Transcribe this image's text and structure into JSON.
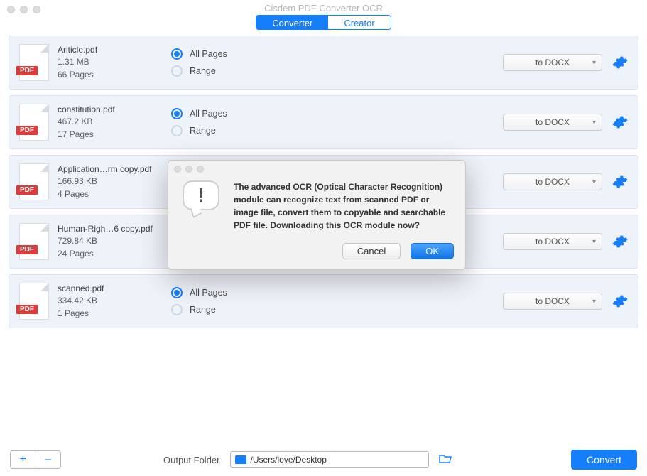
{
  "title": "Cisdem PDF Converter OCR",
  "tabs": {
    "converter": "Converter",
    "creator": "Creator",
    "active": "converter"
  },
  "icon_label": "PDF",
  "radio_labels": {
    "all": "All Pages",
    "range": "Range"
  },
  "files": [
    {
      "name": "Ariticle.pdf",
      "size": "1.31 MB",
      "pages": "66 Pages",
      "range": "all",
      "format": "to DOCX"
    },
    {
      "name": "constitution.pdf",
      "size": "467.2 KB",
      "pages": "17 Pages",
      "range": "all",
      "format": "to DOCX"
    },
    {
      "name": "Application…rm copy.pdf",
      "size": "166.93 KB",
      "pages": "4 Pages",
      "range": "all",
      "format": "to DOCX"
    },
    {
      "name": "Human-Righ…6 copy.pdf",
      "size": "729.84 KB",
      "pages": "24 Pages",
      "range": "all",
      "format": "to DOCX"
    },
    {
      "name": "scanned.pdf",
      "size": "334.42 KB",
      "pages": "1 Pages",
      "range": "all",
      "format": "to DOCX"
    }
  ],
  "output": {
    "label": "Output Folder",
    "path": "/Users/love/Desktop"
  },
  "convert_label": "Convert",
  "add_label": "+",
  "remove_label": "–",
  "dialog": {
    "message": "The advanced OCR (Optical Character Recognition) module can recognize text from scanned PDF or image file, convert them to copyable and searchable PDF file. Downloading this OCR module now?",
    "cancel": "Cancel",
    "ok": "OK"
  }
}
